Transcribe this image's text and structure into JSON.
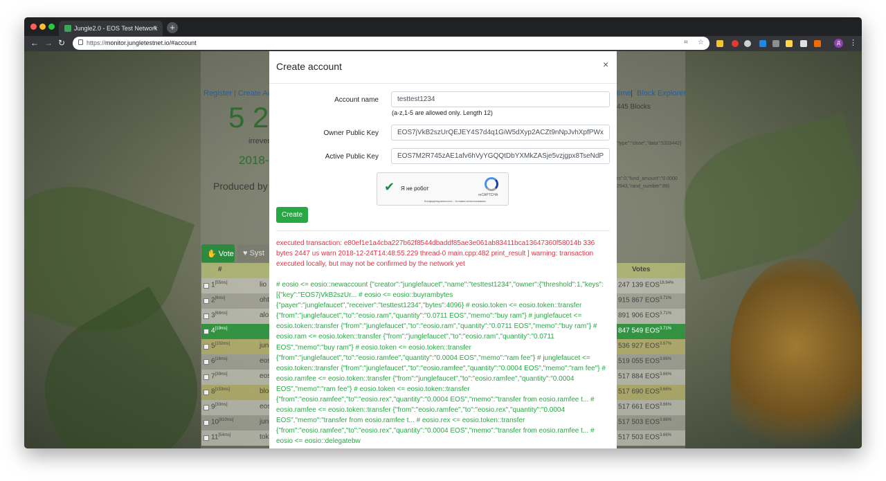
{
  "browser": {
    "tab_title": "Jungle2.0 - EOS Test Network",
    "tab_close": "×",
    "new_tab": "+",
    "url_scheme": "https://",
    "url_rest": "monitor.jungletestnet.io/#account"
  },
  "background": {
    "nav_left": "Register | Create Acc",
    "nav_right_1": "time",
    "nav_right_sep": " | ",
    "nav_right_2": "Block Explorer",
    "head_block": "5 2",
    "irreversible": "irrever",
    "date": "2018-",
    "blocks_count": "445 Blocks",
    "produced_by": "Produced by",
    "json_1": "\"type\":\"close\",\"data\":5203442}",
    "json_2": "rs\":0,\"fund_amount\":\"0.0000",
    "json_3": "2943,\"rand_number\":89}",
    "vote_btn": "Vote",
    "sys_btn": "Syst",
    "col_num": "#",
    "col_votes": "Votes",
    "rows": [
      {
        "n": "1",
        "ms": "[55ms]",
        "name": "lio",
        "votes": "247 139 EOS",
        "pct": "18.94%"
      },
      {
        "n": "2",
        "ms": "[6ms]",
        "name": "oht",
        "votes": "915 867 EOS",
        "pct": "3.71%"
      },
      {
        "n": "3",
        "ms": "[68ms]",
        "name": "aloh",
        "votes": "891 906 EOS",
        "pct": "3.71%"
      },
      {
        "n": "4",
        "ms": "[19ms]",
        "name": "",
        "votes": "847 549 EOS",
        "pct": "3.71%"
      },
      {
        "n": "5",
        "ms": "[102ms]",
        "name": "jungl",
        "votes": "536 927 EOS",
        "pct": "3.67%"
      },
      {
        "n": "6",
        "ms": "[16ms]",
        "name": "eos",
        "votes": "519 055 EOS",
        "pct": "3.66%"
      },
      {
        "n": "7",
        "ms": "[39ms]",
        "name": "eos",
        "votes": "517 884 EOS",
        "pct": "3.66%"
      },
      {
        "n": "8",
        "ms": "[153ms]",
        "name": "bloc",
        "votes": "517 690 EOS",
        "pct": "3.66%"
      },
      {
        "n": "9",
        "ms": "[30ms]",
        "name": "eos",
        "votes": "517 661 EOS",
        "pct": "3.66%"
      },
      {
        "n": "10",
        "ms": "[810ms]",
        "name": "jung",
        "votes": "517 503 EOS",
        "pct": "3.66%"
      },
      {
        "n": "11",
        "ms": "[54ms]",
        "name": "tok",
        "votes": "517 503 EOS",
        "pct": "3.66%"
      }
    ]
  },
  "modal": {
    "title": "Create account",
    "close": "×",
    "account_name_label": "Account name",
    "account_name_value": "testtest1234",
    "account_hint": "(a-z,1-5 are allowed only. Length 12)",
    "owner_key_label": "Owner Public Key",
    "owner_key_value": "EOS7jVkB2szUrQEJEY4S7d4q1GiW5dXyp2ACZt9nNpJvhXpfPWx",
    "active_key_label": "Active Public Key",
    "active_key_value": "EOS7M2R745zAE1afv6hVyYGQQtDbYXMkZASje5vzjgpx8TseNdP",
    "recaptcha_label": "Я не робот",
    "recaptcha_brand": "reCAPTCHA",
    "recaptcha_terms": "Конфиденциальность - Условия использования",
    "create_button": "Create",
    "output_warning": "executed transaction: e80ef1e1a4cba227b62f8544dbaddf85ae3e061ab83411bca13647360f58014b 336 bytes 2447 us warn 2018-12-24T14:48:55.229 thread-0 main.cpp:482 print_result ] warning: transaction executed locally, but may not be confirmed by the network yet",
    "output_log": "# eosio <= eosio::newaccount {\"creator\":\"junglefaucet\",\"name\":\"testtest1234\",\"owner\":{\"threshold\":1,\"keys\":[{\"key\":\"EOS7jVkB2szUr... # eosio <= eosio::buyrambytes {\"payer\":\"junglefaucet\",\"receiver\":\"testtest1234\",\"bytes\":4096} # eosio.token <= eosio.token::transfer {\"from\":\"junglefaucet\",\"to\":\"eosio.ram\",\"quantity\":\"0.0711 EOS\",\"memo\":\"buy ram\"} # junglefaucet <= eosio.token::transfer {\"from\":\"junglefaucet\",\"to\":\"eosio.ram\",\"quantity\":\"0.0711 EOS\",\"memo\":\"buy ram\"} # eosio.ram <= eosio.token::transfer {\"from\":\"junglefaucet\",\"to\":\"eosio.ram\",\"quantity\":\"0.0711 EOS\",\"memo\":\"buy ram\"} # eosio.token <= eosio.token::transfer {\"from\":\"junglefaucet\",\"to\":\"eosio.ramfee\",\"quantity\":\"0.0004 EOS\",\"memo\":\"ram fee\"} # junglefaucet <= eosio.token::transfer {\"from\":\"junglefaucet\",\"to\":\"eosio.ramfee\",\"quantity\":\"0.0004 EOS\",\"memo\":\"ram fee\"} # eosio.ramfee <= eosio.token::transfer {\"from\":\"junglefaucet\",\"to\":\"eosio.ramfee\",\"quantity\":\"0.0004 EOS\",\"memo\":\"ram fee\"} # eosio.token <= eosio.token::transfer {\"from\":\"eosio.ramfee\",\"to\":\"eosio.rex\",\"quantity\":\"0.0004 EOS\",\"memo\":\"transfer from eosio.ramfee t... # eosio.ramfee <= eosio.token::transfer {\"from\":\"eosio.ramfee\",\"to\":\"eosio.rex\",\"quantity\":\"0.0004 EOS\",\"memo\":\"transfer from eosio.ramfee t... # eosio.rex <= eosio.token::transfer {\"from\":\"eosio.ramfee\",\"to\":\"eosio.rex\",\"quantity\":\"0.0004 EOS\",\"memo\":\"transfer from eosio.ramfee t... # eosio <= eosio::delegatebw"
  },
  "colors": {
    "accent_green": "#28a745",
    "error_red": "#dc3545",
    "link_blue": "#2b5d94"
  }
}
